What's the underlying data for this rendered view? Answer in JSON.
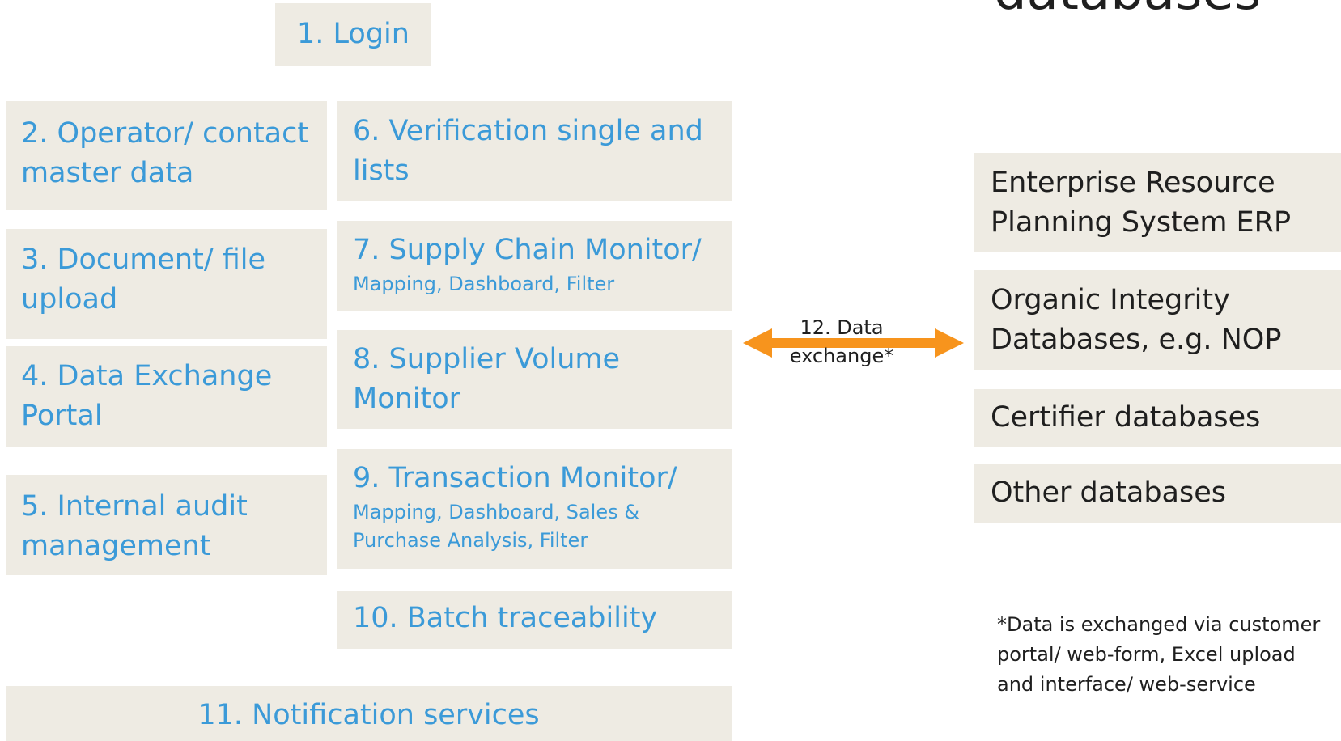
{
  "heading": "databases",
  "modules": {
    "login": "1. Login",
    "operator": "2. Operator/ contact master data",
    "document": "3. Document/ file upload",
    "data_exchange_portal": "4. Data Exchange Portal",
    "internal_audit": "5. Internal audit management",
    "verification": "6. Verification single and lists",
    "supply_chain": {
      "title": "7. Supply Chain Monitor/",
      "sub": "Mapping, Dashboard, Filter"
    },
    "supplier_volume": "8. Supplier Volume Monitor",
    "transaction": {
      "title": "9. Transaction Monitor/",
      "sub": "Mapping, Dashboard, Sales & Purchase Analysis, Filter"
    },
    "batch": "10. Batch traceability",
    "notification": "11. Notification services"
  },
  "arrow": {
    "label": "12. Data exchange*",
    "color": "#f7941d"
  },
  "external": {
    "erp": "Enterprise Resource Planning System ERP",
    "organic": "Organic Integrity Databases, e.g. NOP",
    "certifier": "Certifier databases",
    "other": "Other databases"
  },
  "footnote": "*Data is exchanged via customer portal/ web-form, Excel upload and interface/ web-service",
  "colors": {
    "box_fill": "#eeebe3",
    "module_text": "#3b9ad8",
    "external_text": "#1f1f1f"
  }
}
